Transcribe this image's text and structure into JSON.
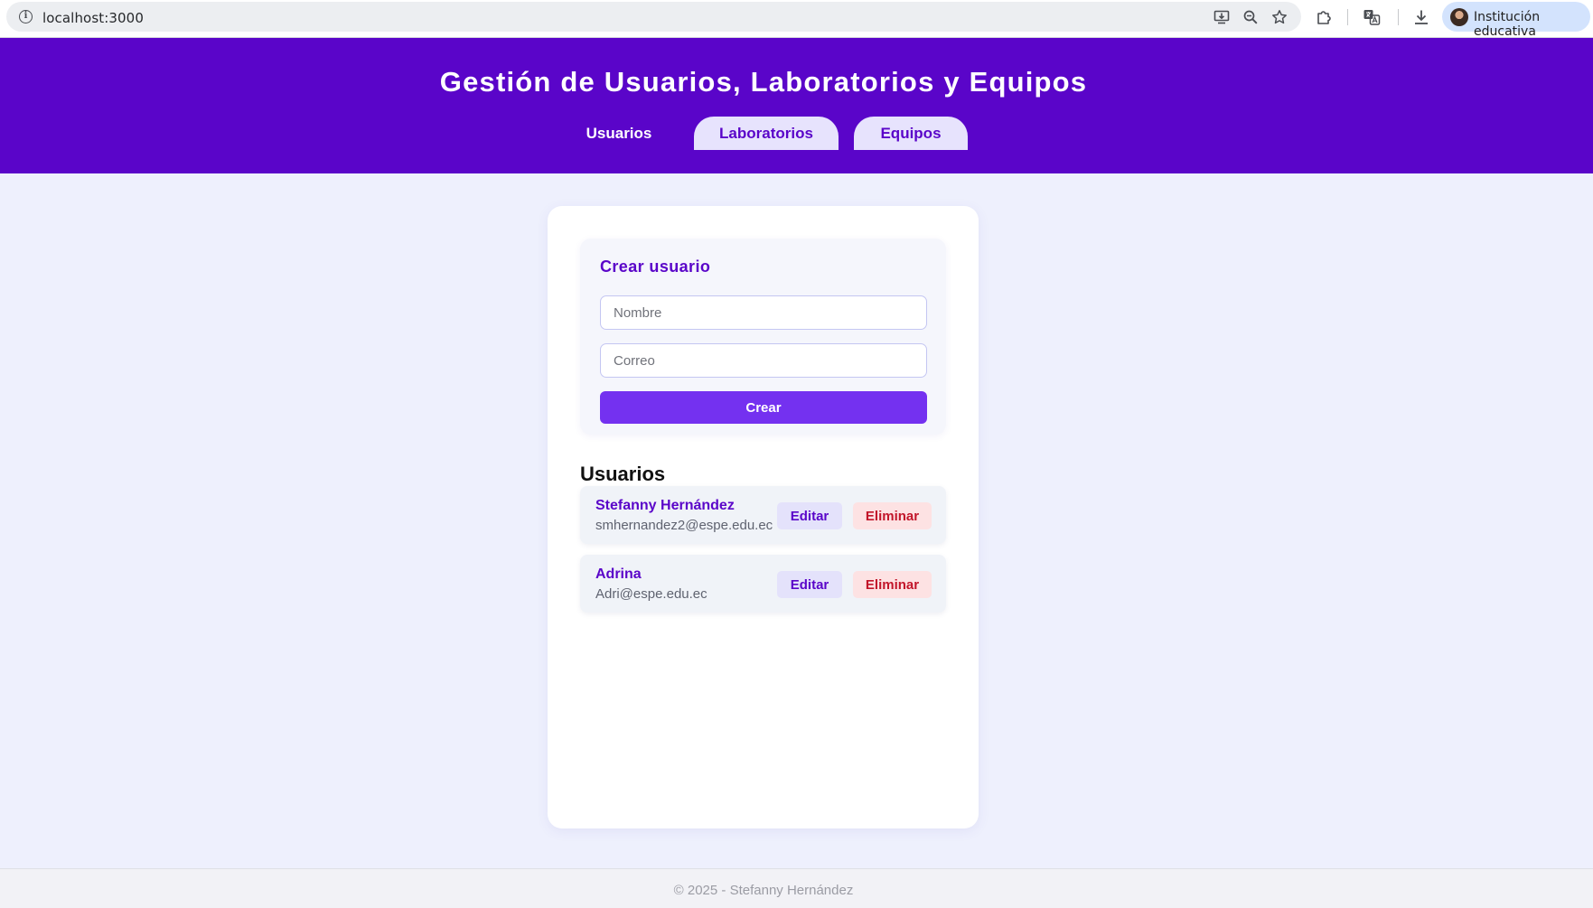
{
  "browser": {
    "url": "localhost:3000",
    "profile_label": "Institución educativa"
  },
  "header": {
    "title": "Gestión de Usuarios, Laboratorios y Equipos",
    "tabs": [
      {
        "label": "Usuarios",
        "active": true
      },
      {
        "label": "Laboratorios",
        "active": false
      },
      {
        "label": "Equipos",
        "active": false
      }
    ]
  },
  "form": {
    "title": "Crear usuario",
    "name_placeholder": "Nombre",
    "email_placeholder": "Correo",
    "submit_label": "Crear"
  },
  "users": {
    "heading": "Usuarios",
    "items": [
      {
        "name": "Stefanny Hernández",
        "email": "smhernandez2@espe.edu.ec",
        "edit_label": "Editar",
        "delete_label": "Eliminar"
      },
      {
        "name": "Adrina",
        "email": "Adri@espe.edu.ec",
        "edit_label": "Editar",
        "delete_label": "Eliminar"
      }
    ]
  },
  "footer": {
    "text": "© 2025 - Stefanny Hernández"
  },
  "colors": {
    "primary": "#5a05c9",
    "button": "#7431f0",
    "danger": "#c2152a",
    "page_background": "#eef0fd"
  },
  "icons": {
    "browser": [
      "info-icon",
      "install-app-icon",
      "zoom-icon",
      "bookmark-star-icon",
      "extensions-icon",
      "translate-icon",
      "download-icon",
      "profile-avatar"
    ]
  }
}
